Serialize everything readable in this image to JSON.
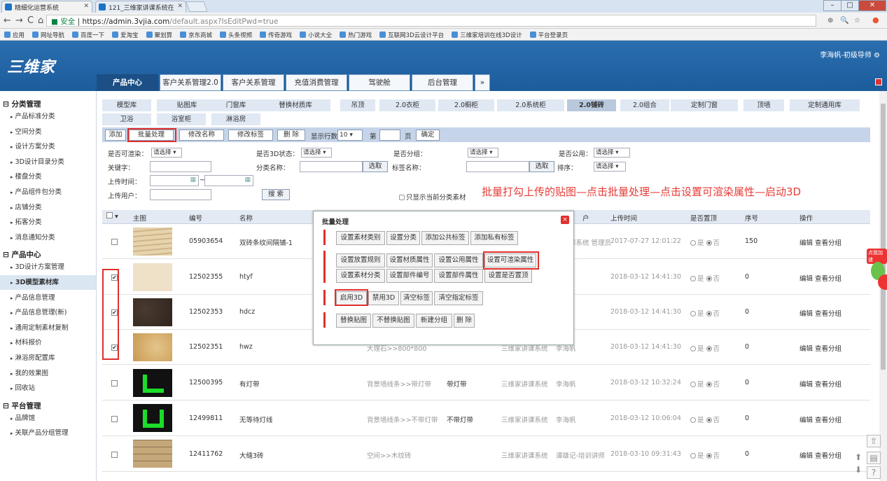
{
  "browser": {
    "tabs": [
      "精细化运营系统",
      "121_三维家讲课系统在"
    ],
    "url_secure": "安全",
    "url_domain": "https://admin.3vjia.com",
    "url_path": "/default.aspx?IsEditPwd=true",
    "bookmarks": [
      "应用",
      "网址导航",
      "百度一下",
      "爱淘宝",
      "聚划算",
      "京东商城",
      "头条视频",
      "传奇游戏",
      "小说大全",
      "热门游戏",
      "互联网3D云设计平台",
      "三维家培训在线3D设计",
      "平台登录页"
    ]
  },
  "header": {
    "logo": "三维家",
    "user": "李海帆-初级导师",
    "main_tabs": [
      "产品中心",
      "客户关系管理2.0",
      "客户关系管理",
      "充值消费管理",
      "驾驶舱",
      "后台管理"
    ]
  },
  "sidebar": {
    "groups": [
      {
        "title": "分类管理",
        "items": [
          "产品标准分类",
          "空间分类",
          "设计方案分类",
          "3D设计目录分类",
          "楼盘分类",
          "产品组件包分类",
          "店铺分类",
          "拓客分类",
          "消息通知分类"
        ]
      },
      {
        "title": "产品中心",
        "items": [
          "3D设计方案管理",
          "3D模型素材库",
          "产品信息管理",
          "产品信息管理(新)",
          "通用定制素材复制",
          "材料报价",
          "淋浴房配置库",
          "我的效果图",
          "回收站"
        ]
      },
      {
        "title": "平台管理",
        "items": [
          "品牌馆",
          "关联产品分组管理"
        ]
      }
    ],
    "active_item": "3D模型素材库"
  },
  "category_tabs": [
    "模型库",
    "贴图库",
    "门窗库",
    "替换材质库",
    "吊顶",
    "2.0衣柜",
    "2.0橱柜",
    "2.0系统柜",
    "2.0铺砖",
    "2.0组合",
    "定制门窗",
    "顶墙",
    "定制通用库",
    "卫浴",
    "浴室柜",
    "淋浴房"
  ],
  "active_category": "2.0铺砖",
  "toolbar": {
    "add": "添加",
    "batch": "批量处理",
    "edit_name": "修改名称",
    "edit_tag": "修改标签",
    "delete": "删 除",
    "rows_label": "显示行数",
    "rows_value": "10",
    "page_prefix": "第",
    "page_suffix": "页",
    "confirm": "确定"
  },
  "filters": {
    "renderable_label": "是否可渲染：",
    "renderable_value": "请选择",
    "status3d_label": "是否3D状态：",
    "status3d_value": "请选择",
    "grouped_label": "是否分组：",
    "grouped_value": "请选择",
    "public_label": "是否公用：",
    "public_value": "请选择",
    "keyword_label": "关键字：",
    "category_label": "分类名称：",
    "pick_button": "选取",
    "tag_label": "标签名称：",
    "pick_button2": "选取",
    "sort_label": "排序：",
    "sort_value": "请选择",
    "upload_time_label": "上传时间：",
    "uploader_label": "上传用户：",
    "search_button": "搜 索",
    "only_current": "只显示当前分类素材"
  },
  "annotation": "批量打勾上传的贴图—点击批量处理—点击设置可渲染属性—启动3D",
  "table": {
    "headers": [
      "主图",
      "编号",
      "名称",
      "户",
      "上传时间",
      "是否置顶",
      "序号",
      "操作"
    ],
    "rows": [
      {
        "checked": false,
        "id": "05903654",
        "name": "双砖条纹间隔铺-1",
        "category": "",
        "tag": "",
        "system": "",
        "owner": "家讲课系统 管理员",
        "time": "2017-07-27 12:01:22",
        "top": "否",
        "seq": "150",
        "ops": "编辑 查看分组",
        "thumb": "wave"
      },
      {
        "checked": true,
        "id": "12502355",
        "name": "htyf",
        "category": "",
        "tag": "",
        "system": "",
        "owner": "帆",
        "time": "2018-03-12 14:41:30",
        "top": "否",
        "seq": "0",
        "ops": "编辑 查看分组",
        "thumb": "beige"
      },
      {
        "checked": true,
        "id": "12502353",
        "name": "hdcz",
        "category": "",
        "tag": "",
        "system": "",
        "owner": "帆",
        "time": "2018-03-12 14:41:30",
        "top": "否",
        "seq": "0",
        "ops": "编辑 查看分组",
        "thumb": "dark"
      },
      {
        "checked": true,
        "id": "12502351",
        "name": "hwz",
        "category": "大理石>>800*800",
        "tag": "",
        "system": "三维家讲课系统",
        "owner": "李海帆",
        "time": "2018-03-12 14:41:30",
        "top": "否",
        "seq": "0",
        "ops": "编辑 查看分组",
        "thumb": "marble"
      },
      {
        "checked": false,
        "id": "12500395",
        "name": "有灯带",
        "category": "背景墙线条>>带灯带",
        "tag": "带灯带",
        "system": "三维家讲课系统",
        "owner": "李海帆",
        "time": "2018-03-12 10:32:24",
        "top": "否",
        "seq": "0",
        "ops": "编辑 查看分组",
        "thumb": "green1"
      },
      {
        "checked": false,
        "id": "12499811",
        "name": "无等待灯线",
        "category": "背景墙线条>>不带灯带",
        "tag": "不带灯带",
        "system": "三维家讲课系统",
        "owner": "李海帆",
        "time": "2018-03-12 10:06:04",
        "top": "否",
        "seq": "0",
        "ops": "编辑 查看分组",
        "thumb": "green2"
      },
      {
        "checked": false,
        "id": "12411762",
        "name": "大缝3砖",
        "category": "空间>>木纹砖",
        "tag": "",
        "system": "三维家讲课系统",
        "owner": "谭雄记-培训讲师",
        "time": "2018-03-10 09:31:43",
        "top": "否",
        "seq": "0",
        "ops": "编辑 查看分组",
        "thumb": "brick"
      }
    ],
    "radio_yes": "是",
    "radio_no": "否"
  },
  "modal": {
    "title": "批量处理",
    "close": "×",
    "group1": [
      "设置素材类别",
      "设置分类",
      "添加公共标签",
      "添加私有标签"
    ],
    "group2a": [
      "设置放置规则",
      "设置材质属性",
      "设置公用属性",
      "设置可渲染属性"
    ],
    "group2b": [
      "设置素材分类",
      "设置部件编号",
      "设置部件属性",
      "设置是否置顶"
    ],
    "group3": [
      "启用3D",
      "禁用3D",
      "清空标签",
      "清空指定标签"
    ],
    "group4": [
      "替换贴图",
      "不替换贴图",
      "新建分组",
      "删 除"
    ]
  },
  "colors": {
    "accent": "#1b4f85",
    "highlight": "#e0302c",
    "annotation": "#e63b36",
    "toolbar": "#c5d4e8"
  }
}
